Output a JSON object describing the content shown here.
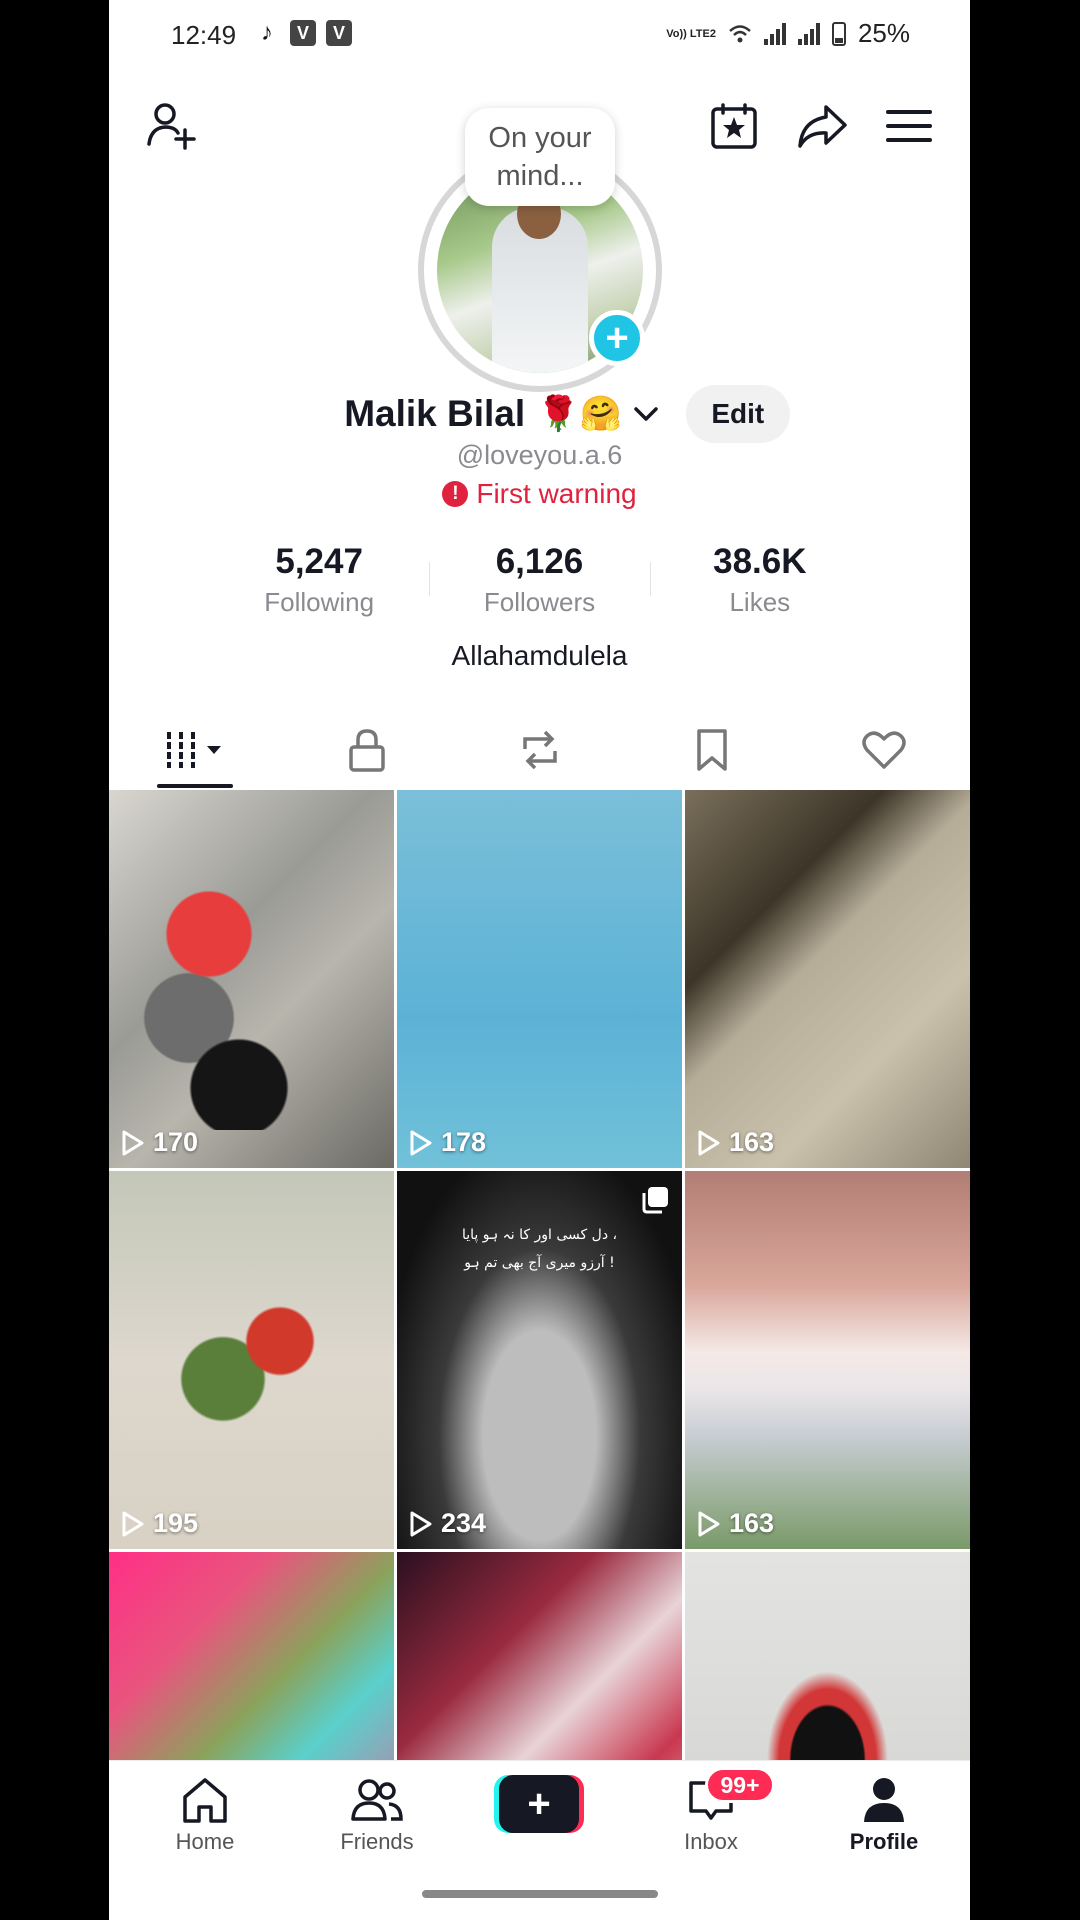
{
  "status_bar": {
    "time": "12:49",
    "network_label": "Vo)) LTE2",
    "battery": "25%",
    "app_icons": [
      "tiktok-icon",
      "v-app-icon",
      "v-app-icon"
    ]
  },
  "header": {
    "bubble_text": "On your mind...",
    "icons": [
      "add-friend-icon",
      "calendar-star-icon",
      "share-icon",
      "menu-icon"
    ]
  },
  "profile": {
    "name": "Malik Bilal",
    "name_emoji": "🌹🤗",
    "edit_label": "Edit",
    "handle": "@loveyou.a.6",
    "warning": "First warning",
    "bio": "Allahamdulela",
    "accent_color": "#20c5e6",
    "warning_color": "#e0223e"
  },
  "stats": [
    {
      "value": "5,247",
      "label": "Following"
    },
    {
      "value": "6,126",
      "label": "Followers"
    },
    {
      "value": "38.6K",
      "label": "Likes"
    }
  ],
  "tabs": [
    "videos-grid-icon",
    "lock-icon",
    "repost-icon",
    "bookmark-icon",
    "heart-icon"
  ],
  "videos": [
    {
      "views": "170"
    },
    {
      "views": "178"
    },
    {
      "views": "163"
    },
    {
      "views": "195"
    },
    {
      "views": "234"
    },
    {
      "views": "163"
    },
    {
      "views": ""
    },
    {
      "views": ""
    },
    {
      "views": ""
    }
  ],
  "video_overlay_text": [
    "دل کسی اور کا نہ ہو پایا ،",
    "آرزو میری آج بھی تم ہو !"
  ],
  "nav": {
    "home": "Home",
    "friends": "Friends",
    "inbox": "Inbox",
    "inbox_badge": "99+",
    "profile": "Profile"
  }
}
